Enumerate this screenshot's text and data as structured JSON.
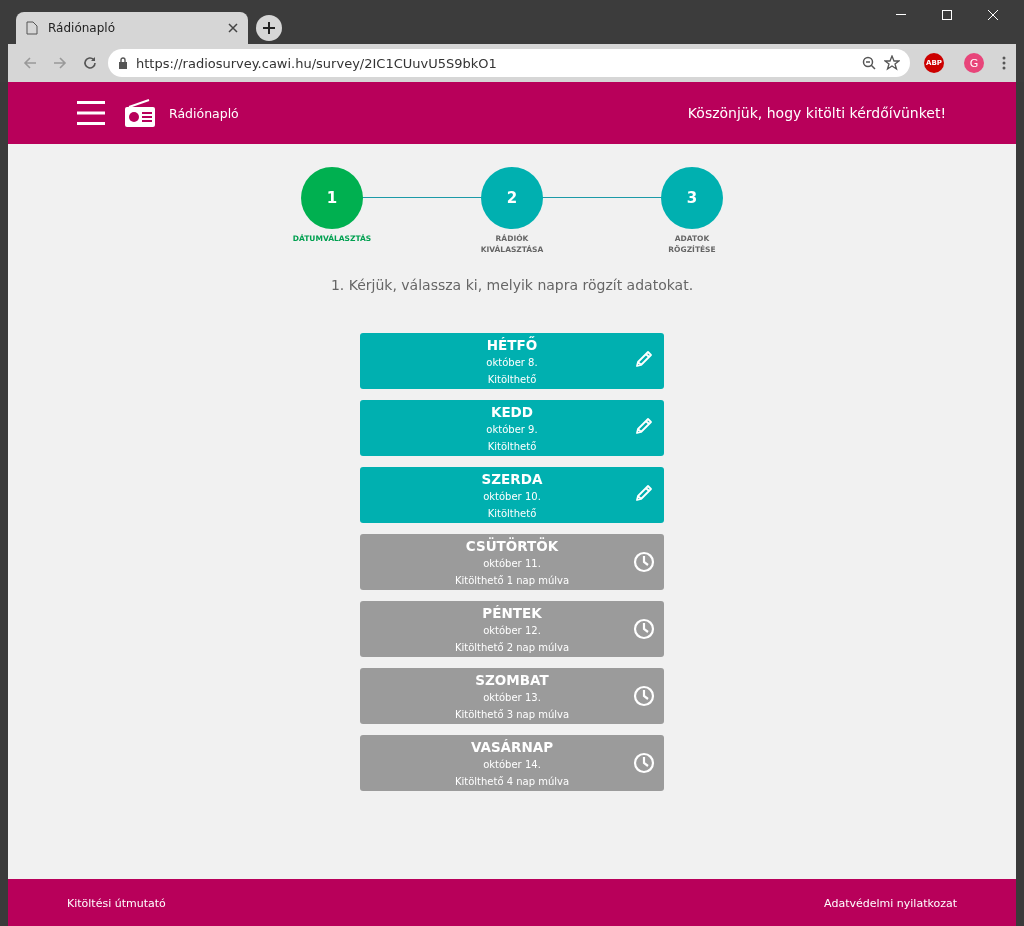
{
  "browser": {
    "tab_title": "Rádiónapló",
    "url": "https://radiosurvey.cawi.hu/survey/2IC1CUuvU5S9bkO1",
    "extension_badge": "ABP",
    "profile_initial": "G"
  },
  "header": {
    "app_name": "Rádiónapló",
    "greeting": "Köszönjük, hogy kitölti kérdőívünket!"
  },
  "steps": [
    {
      "number": "1",
      "label": "DÁTUMVÁLASZTÁS",
      "selected": true
    },
    {
      "number": "2",
      "label": "RÁDIÓK KIVÁLASZTÁSA",
      "selected": false
    },
    {
      "number": "3",
      "label": "ADATOK RÖGZÍTÉSE",
      "selected": false
    }
  ],
  "instruction": "1. Kérjük, válassza ki, melyik napra rögzít adatokat.",
  "days": [
    {
      "day": "HÉTFŐ",
      "date": "október 8.",
      "status": "Kitölthető",
      "kind": "open"
    },
    {
      "day": "KEDD",
      "date": "október 9.",
      "status": "Kitölthető",
      "kind": "open"
    },
    {
      "day": "SZERDA",
      "date": "október 10.",
      "status": "Kitölthető",
      "kind": "open"
    },
    {
      "day": "CSÜTÖRTÖK",
      "date": "október 11.",
      "status": "Kitölthető 1 nap múlva",
      "kind": "waiting"
    },
    {
      "day": "PÉNTEK",
      "date": "október 12.",
      "status": "Kitölthető 2 nap múlva",
      "kind": "waiting"
    },
    {
      "day": "SZOMBAT",
      "date": "október 13.",
      "status": "Kitölthető 3 nap múlva",
      "kind": "waiting"
    },
    {
      "day": "VASÁRNAP",
      "date": "október 14.",
      "status": "Kitölthető 4 nap múlva",
      "kind": "waiting"
    }
  ],
  "footer": {
    "left_link": "Kitöltési útmutató",
    "right_link": "Adatvédelmi nyilatkozat"
  }
}
